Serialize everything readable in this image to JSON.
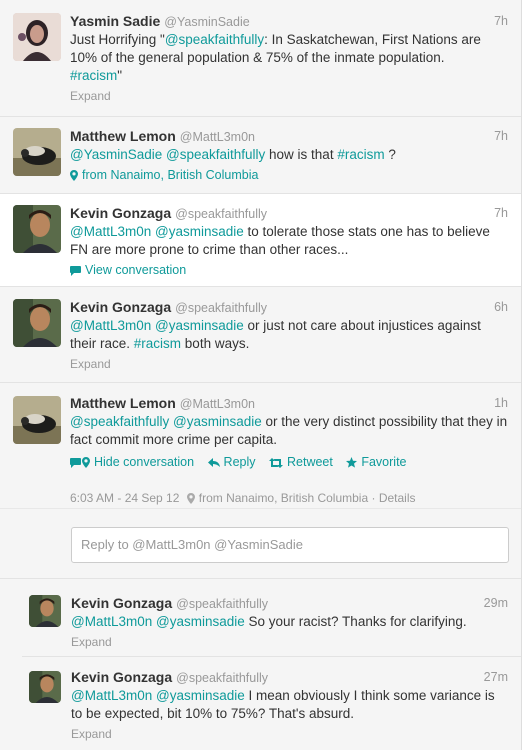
{
  "tweets": [
    {
      "name": "Yasmin Sadie",
      "handle": "@YasminSadie",
      "time": "7h",
      "text_pre": "Just Horrifying \"",
      "mention1": "@speakfaithfully",
      "text_mid": ": In Saskatchewan, First Nations are 10% of the general population & 75% of the inmate population.",
      "hashtag": "#racism",
      "text_post": "\"",
      "footer": "Expand"
    },
    {
      "name": "Matthew Lemon",
      "handle": "@MattL3m0n",
      "time": "7h",
      "mention1": "@YasminSadie",
      "mention2": "@speakfaithfully",
      "text_mid": " how is that ",
      "hashtag": "#racism",
      "text_post": " ?",
      "location": "from Nanaimo, British Columbia"
    },
    {
      "name": "Kevin Gonzaga",
      "handle": "@speakfaithfully",
      "time": "7h",
      "mention1": "@MattL3m0n",
      "mention2": "@yasminsadie",
      "text_post": " to tolerate those stats one has to believe FN are more prone to crime than other races...",
      "footer": "View conversation"
    },
    {
      "name": "Kevin Gonzaga",
      "handle": "@speakfaithfully",
      "time": "6h",
      "mention1": "@MattL3m0n",
      "mention2": "@yasminsadie",
      "text_mid": " or just not care about injustices against their race. ",
      "hashtag": "#racism",
      "text_post": " both ways.",
      "footer": "Expand"
    },
    {
      "name": "Matthew Lemon",
      "handle": "@MattL3m0n",
      "time": "1h",
      "mention1": "@speakfaithfully",
      "mention2": "@yasminsadie",
      "text_post": " or the very distinct possibility that they in fact commit more crime per capita.",
      "actions": {
        "hide": "Hide conversation",
        "reply": "Reply",
        "retweet": "Retweet",
        "favorite": "Favorite"
      },
      "detail": {
        "datetime": "6:03 AM - 24 Sep 12",
        "location": "from Nanaimo, British Columbia",
        "separator": "·",
        "details": "Details"
      }
    },
    {
      "name": "Kevin Gonzaga",
      "handle": "@speakfaithfully",
      "time": "29m",
      "mention1": "@MattL3m0n",
      "mention2": "@yasminsadie",
      "text_post": " So your racist? Thanks for clarifying.",
      "footer": "Expand"
    },
    {
      "name": "Kevin Gonzaga",
      "handle": "@speakfaithfully",
      "time": "27m",
      "mention1": "@MattL3m0n",
      "mention2": "@yasminsadie",
      "text_post": " I mean obviously I think some variance is to be expected, bit 10% to 75%? That's absurd.",
      "footer": "Expand"
    }
  ],
  "reply_box": {
    "placeholder": "Reply to @MattL3m0n @YasminSadie"
  },
  "colors": {
    "link": "#0f9a9a",
    "muted": "#999999",
    "text": "#333333"
  }
}
